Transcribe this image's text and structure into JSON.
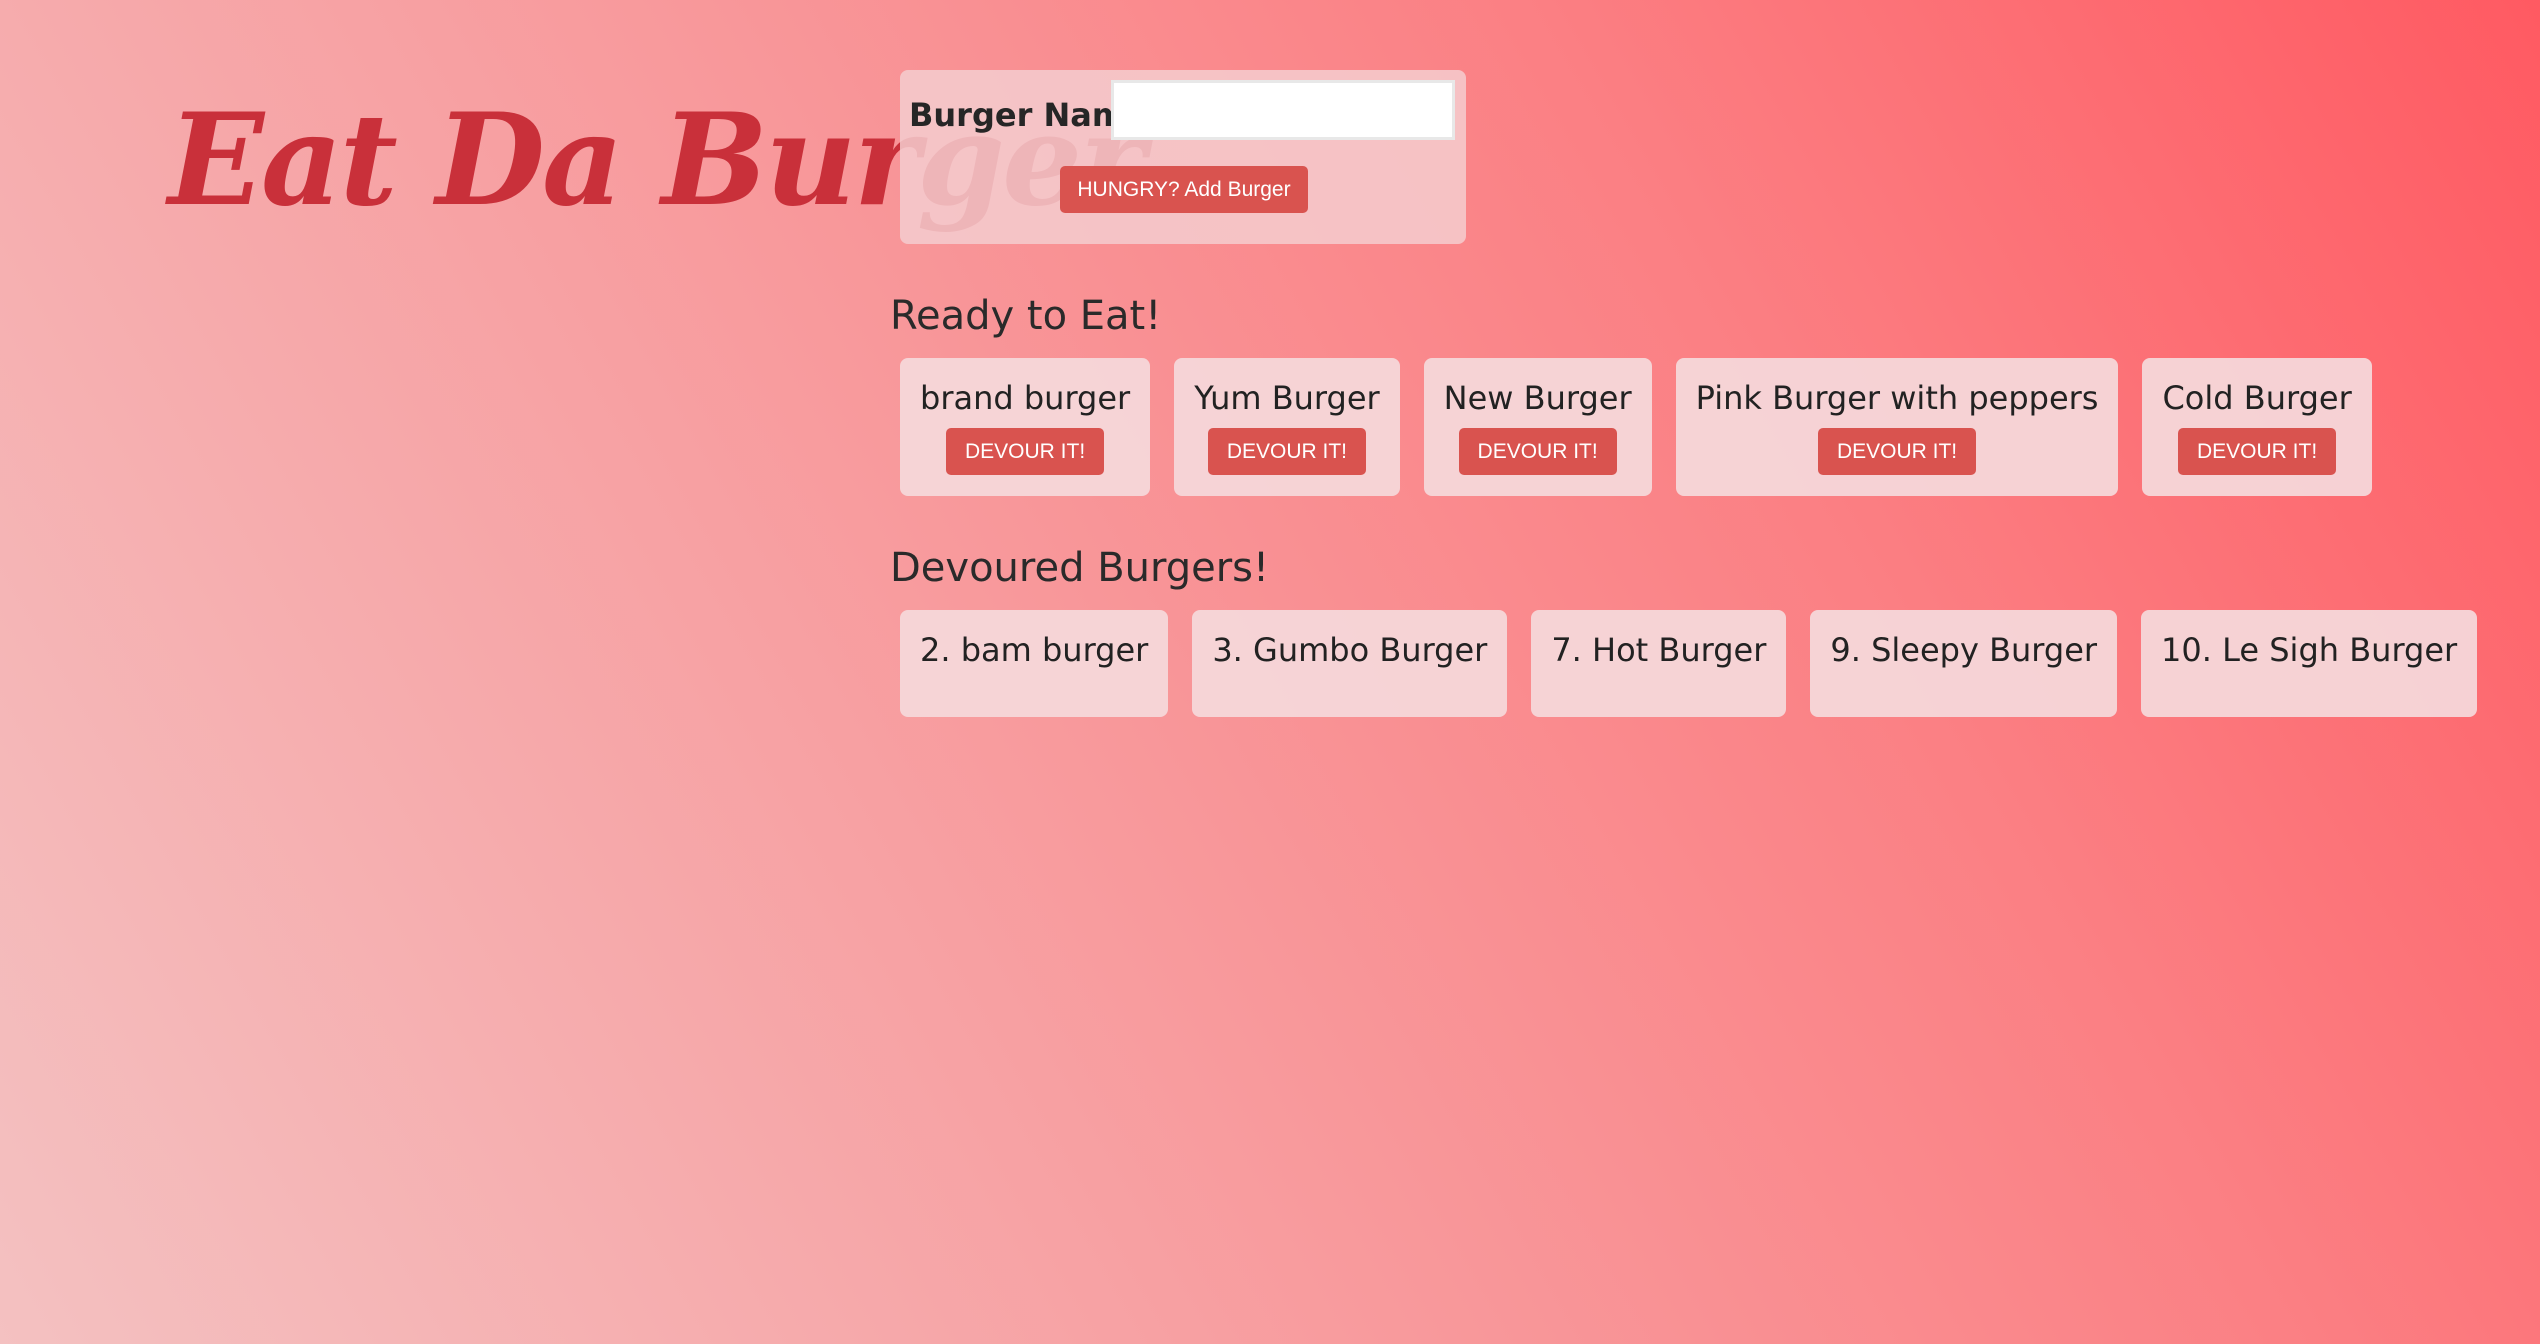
{
  "app": {
    "title": "Eat Da Burger"
  },
  "form": {
    "label": "Burger Name:",
    "input_value": "",
    "submit_label": "HUNGRY? Add Burger"
  },
  "ready": {
    "title": "Ready to Eat!",
    "devour_label": "DEVOUR IT!",
    "burgers": [
      {
        "name": "brand burger"
      },
      {
        "name": "Yum Burger"
      },
      {
        "name": "New Burger"
      },
      {
        "name": "Pink Burger with peppers"
      },
      {
        "name": "Cold Burger"
      }
    ]
  },
  "devoured": {
    "title": "Devoured Burgers!",
    "burgers": [
      {
        "name": "2. bam burger"
      },
      {
        "name": "3. Gumbo Burger"
      },
      {
        "name": "7. Hot Burger"
      },
      {
        "name": "9. Sleepy Burger"
      },
      {
        "name": "10. Le Sigh Burger"
      }
    ]
  },
  "colors": {
    "brand": "#c9303a",
    "button": "#d9534f",
    "gradient_start": "#f4c1c1",
    "gradient_end": "#ff5a62",
    "card_bg": "#f5d7d9"
  }
}
